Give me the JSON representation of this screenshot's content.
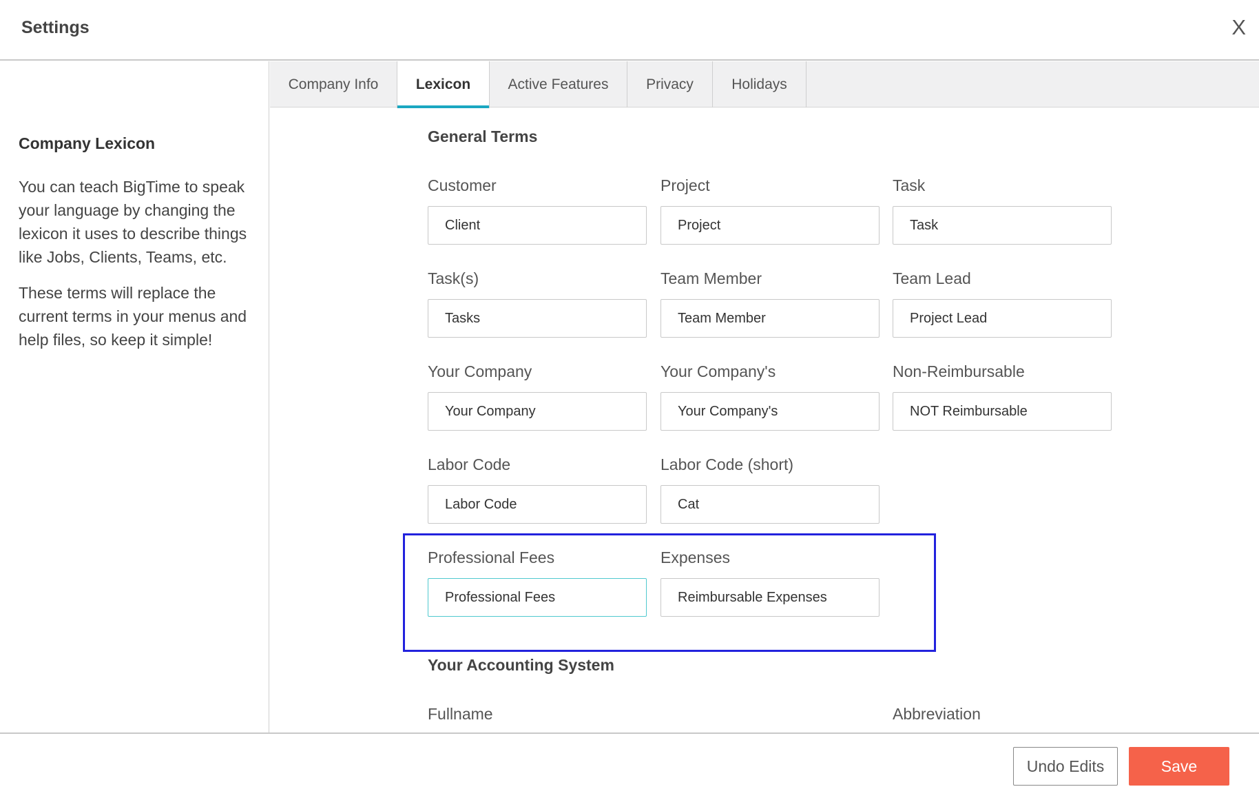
{
  "header": {
    "title": "Settings",
    "close_label": "X"
  },
  "sidebar": {
    "heading": "Company Lexicon",
    "paragraph1": "You can teach BigTime to speak your language by changing the lexicon it uses to describe things like Jobs, Clients, Teams, etc.",
    "paragraph2": "These terms will replace the current terms in your menus and help files, so keep it simple!"
  },
  "tabs": [
    {
      "label": "Company Info"
    },
    {
      "label": "Lexicon",
      "active": true
    },
    {
      "label": "Active Features"
    },
    {
      "label": "Privacy"
    },
    {
      "label": "Holidays"
    }
  ],
  "general_terms": {
    "title": "General Terms",
    "fields": [
      {
        "label": "Customer",
        "value": "Client"
      },
      {
        "label": "Project",
        "value": "Project"
      },
      {
        "label": "Task",
        "value": "Task"
      },
      {
        "label": "Task(s)",
        "value": "Tasks"
      },
      {
        "label": "Team Member",
        "value": "Team Member"
      },
      {
        "label": "Team Lead",
        "value": "Project Lead"
      },
      {
        "label": "Your Company",
        "value": "Your Company"
      },
      {
        "label": "Your Company's",
        "value": "Your Company's"
      },
      {
        "label": "Non-Reimbursable",
        "value": "NOT Reimbursable"
      },
      {
        "label": "Labor Code",
        "value": "Labor Code"
      },
      {
        "label": "Labor Code (short)",
        "value": "Cat"
      },
      {
        "label": "Professional Fees",
        "value": "Professional Fees",
        "focused": true
      },
      {
        "label": "Expenses",
        "value": "Reimbursable Expenses"
      }
    ]
  },
  "accounting": {
    "title": "Your Accounting System",
    "fullname_label": "Fullname",
    "abbreviation_label": "Abbreviation"
  },
  "footer": {
    "undo_label": "Undo Edits",
    "save_label": "Save"
  },
  "colors": {
    "accent": "#1aa7c1",
    "save": "#f5624a",
    "highlight": "#2222dd",
    "focus": "#4fc9cf"
  }
}
